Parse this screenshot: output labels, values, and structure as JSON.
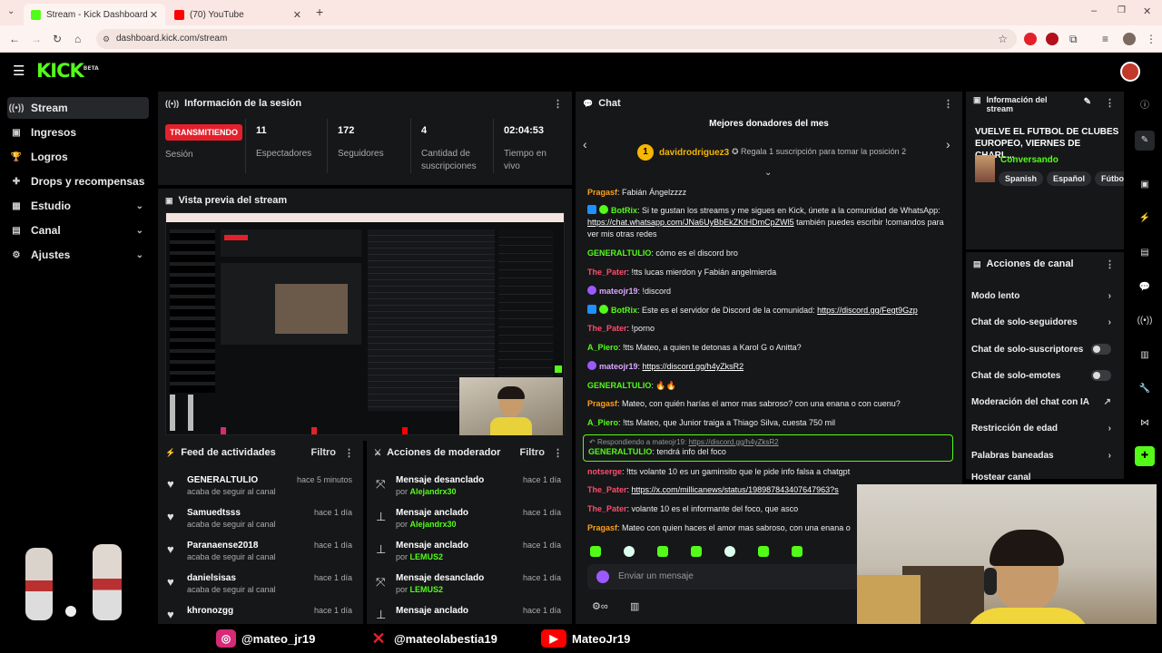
{
  "browser": {
    "tabs": [
      {
        "title": "Stream - Kick Dashboard",
        "active": true
      },
      {
        "title": "(70) YouTube",
        "active": false
      }
    ],
    "url": "dashboard.kick.com/stream"
  },
  "kick": {
    "logo": "KICK",
    "logo_sup": "BETA"
  },
  "sidebar": {
    "items": [
      {
        "label": "Stream",
        "active": true,
        "expand": false
      },
      {
        "label": "Ingresos",
        "expand": false
      },
      {
        "label": "Logros",
        "expand": false
      },
      {
        "label": "Drops y recompensas",
        "expand": false
      },
      {
        "label": "Estudio",
        "expand": true
      },
      {
        "label": "Canal",
        "expand": true
      },
      {
        "label": "Ajustes",
        "expand": true
      }
    ]
  },
  "session": {
    "title": "Información de la sesión",
    "live_badge": "TRANSMITIENDO",
    "live_label": "Sesión",
    "stats": [
      {
        "value": "11",
        "label": "Espectadores"
      },
      {
        "value": "172",
        "label": "Seguidores"
      },
      {
        "value": "4",
        "label": "Cantidad de suscripciones"
      },
      {
        "value": "02:04:53",
        "label": "Tiempo en vivo"
      }
    ]
  },
  "preview": {
    "title": "Vista previa del stream"
  },
  "feed": {
    "title": "Feed de actividades",
    "filter": "Filtro",
    "items": [
      {
        "name": "GENERALTULIO",
        "sub": "acaba de seguir al canal",
        "time": "hace 5 minutos"
      },
      {
        "name": "Samuedtsss",
        "sub": "acaba de seguir al canal",
        "time": "hace 1 día"
      },
      {
        "name": "Paranaense2018",
        "sub": "acaba de seguir al canal",
        "time": "hace 1 día"
      },
      {
        "name": "danielsisas",
        "sub": "acaba de seguir al canal",
        "time": "hace 1 día"
      },
      {
        "name": "khronozgg",
        "sub": "",
        "time": "hace 1 día"
      }
    ]
  },
  "modactions": {
    "title": "Acciones de moderador",
    "filter": "Filtro",
    "by": "por",
    "items": [
      {
        "action": "Mensaje desanclado",
        "user": "Alejandrx30",
        "time": "hace 1 día"
      },
      {
        "action": "Mensaje anclado",
        "user": "Alejandrx30",
        "time": "hace 1 día"
      },
      {
        "action": "Mensaje anclado",
        "user": "LEMUS2",
        "time": "hace 1 día"
      },
      {
        "action": "Mensaje desanclado",
        "user": "LEMUS2",
        "time": "hace 1 día"
      },
      {
        "action": "Mensaje anclado",
        "user": "",
        "time": "hace 1 día"
      }
    ]
  },
  "chat": {
    "title": "Chat",
    "donors_title": "Mejores donadores del mes",
    "top_donor": "davidrodriguez3",
    "donor_rank": "1",
    "donor_cta": "Regala 1 suscripción para tomar la posición 2",
    "reply_to": "Respondiendo a mateojr19:",
    "reply_link": "https://discord.gg/h4yZksR2",
    "placeholder": "Enviar un mensaje",
    "colors": {
      "green": "#53fc18",
      "pink": "#ff4d6d",
      "orange": "#ff9f1a"
    },
    "messages": [
      {
        "user": "Pragasf",
        "color": "#ff9f1a",
        "text": "Fabián Ángelzzzz"
      },
      {
        "user": "BotRix",
        "color": "#53fc18",
        "bot": true,
        "text": "Si te gustan los streams y me sigues en Kick, únete a la comunidad de WhatsApp:",
        "link": "https://chat.whatsapp.com/JNa6UyBbEkZKtHDmCpZWl5",
        "text2": " también puedes escribir !comandos para ver mis otras redes"
      },
      {
        "user": "GENERALTULIO",
        "color": "#53fc18",
        "text": "cómo es el discord bro"
      },
      {
        "user": "The_Pater",
        "color": "#ff4d6d",
        "text": "!tts lucas mierdon y Fabián angelmierda"
      },
      {
        "user": "mateojr19",
        "color": "#d9a7ff",
        "text": "!discord"
      },
      {
        "user": "BotRix",
        "color": "#53fc18",
        "bot": true,
        "text": "Este es el servidor de Discord de la comunidad:",
        "link": "https://discord.gg/Fegt9Gzp",
        "text2": ""
      },
      {
        "user": "The_Pater",
        "color": "#ff4d6d",
        "text": "!porno"
      },
      {
        "user": "A_Piero",
        "color": "#53fc18",
        "text": "!tts Mateo, a quien te detonas a Karol G o Anitta?"
      },
      {
        "user": "mateojr19",
        "color": "#d9a7ff",
        "text": "",
        "link": "https://discord.gg/h4yZksR2",
        "text2": ""
      },
      {
        "user": "GENERALTULIO",
        "color": "#53fc18",
        "text": "🔥🔥"
      },
      {
        "user": "Pragasf",
        "color": "#ff9f1a",
        "text": "Mateo, con quién harías el amor mas sabroso? con una enana o con cuenu?"
      },
      {
        "user": "A_Piero",
        "color": "#53fc18",
        "text": "!tts Mateo, que Junior traiga a Thiago Silva, cuesta 750 mil"
      },
      {
        "user": "GENERALTULIO",
        "color": "#53fc18",
        "text": "tendrá info del foco",
        "reply": true
      },
      {
        "user": "notserge",
        "color": "#ff4d6d",
        "text": "!tts volante 10 es un gaminsito que le pide info falsa a chatgpt"
      },
      {
        "user": "The_Pater",
        "color": "#ff4d6d",
        "text": "",
        "link": "https://x.com/millicanews/status/198987843407647963?s",
        "text2": ""
      },
      {
        "user": "The_Pater",
        "color": "#ff4d6d",
        "text": "volante 10 es el informante del foco, que asco"
      },
      {
        "user": "Pragasf",
        "color": "#ff9f1a",
        "text": "Mateo con quien haces el amor mas sabroso, con una enana o"
      }
    ]
  },
  "stream_info": {
    "title": "Información del stream",
    "stream_title": "VUELVE EL FUTBOL DE CLUBES EUROPEO, VIERNES DE CHARL...",
    "category": "Conversando",
    "tags": [
      "Spanish",
      "Español",
      "Fútbol"
    ]
  },
  "channel_actions": {
    "title": "Acciones de canal",
    "items": [
      {
        "label": "Modo lento",
        "kind": "chevron"
      },
      {
        "label": "Chat de solo-seguidores",
        "kind": "chevron"
      },
      {
        "label": "Chat de solo-suscriptores",
        "kind": "toggle"
      },
      {
        "label": "Chat de solo-emotes",
        "kind": "toggle"
      },
      {
        "label": "Moderación del chat con IA",
        "kind": "external"
      },
      {
        "label": "Restricción de edad",
        "kind": "chevron"
      },
      {
        "label": "Palabras baneadas",
        "kind": "chevron"
      },
      {
        "label": "Hostear canal",
        "kind": "chevron"
      }
    ]
  },
  "socials": [
    {
      "handle": "@mateo_jr19",
      "network": "instagram",
      "color": "#d62976"
    },
    {
      "handle": "@mateolabestia19",
      "network": "x",
      "color": "#e3212b"
    },
    {
      "handle": "MateoJr19",
      "network": "youtube",
      "color": "#ff0000"
    }
  ]
}
